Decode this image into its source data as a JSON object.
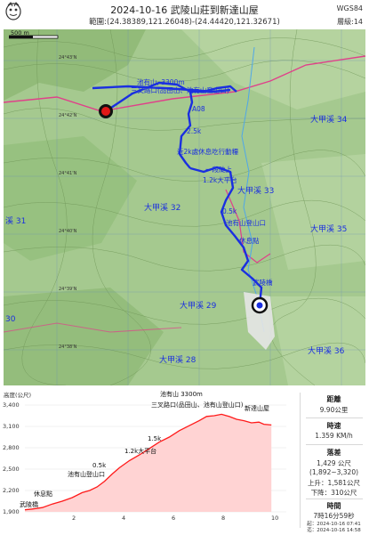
{
  "header": {
    "title": "2024-10-16 武陵山莊到新達山屋",
    "range": "範圍:(24.38389,121.26048)-(24.44420,121.32671)",
    "datum": "WGS84",
    "zoom": "層級:14"
  },
  "map": {
    "scale": "500 m",
    "streams": [
      {
        "label": "大甲溪 34"
      },
      {
        "label": "大甲溪 33"
      },
      {
        "label": "大甲溪 32"
      },
      {
        "label": "大甲溪 35"
      },
      {
        "label": "大甲溪 29"
      },
      {
        "label": "大甲溪 28"
      },
      {
        "label": "大甲溪 36"
      },
      {
        "label": "溪 31"
      },
      {
        "label": "30"
      }
    ],
    "grid_labels": [
      "24°43'N",
      "24°42'N",
      "24°41'N",
      "24°40'N",
      "24°39'N",
      "24°38'N"
    ],
    "waypoints": [
      "池有山, 3300m",
      "三叉路口(品田山、池有山登山口)",
      "A08",
      "2.5k",
      "近2k處休息吃行動糧",
      "一段陡上",
      "1.2k大平台",
      "0.5k",
      "池有山登山口",
      "休息點",
      "武陵橋"
    ],
    "colors": {
      "track": "#1a2fe0",
      "contour": "#7a9e63",
      "boundary": "#e0408a",
      "start": "#e01818",
      "end": "#111111"
    }
  },
  "profile": {
    "ylabel": "高度(公尺)",
    "y_ticks": [
      "3,400",
      "3,100",
      "2,800",
      "2,500",
      "2,200",
      "1,900"
    ],
    "x_ticks": [
      "2",
      "4",
      "6",
      "8",
      "10"
    ],
    "points_label": [
      "池有山 3300m",
      "三叉路口(品田山、池有山登山口)",
      "新達山屋",
      "1.5k",
      "1.2k大平台",
      "0.5k",
      "池有山登山口",
      "休息點",
      "武陵橋"
    ],
    "chart_data": {
      "type": "area",
      "x": [
        0,
        0.3,
        0.7,
        1.1,
        1.5,
        1.9,
        2.3,
        2.6,
        2.9,
        3.2,
        3.5,
        3.8,
        4.2,
        4.6,
        5.0,
        5.4,
        5.8,
        6.2,
        6.6,
        7.0,
        7.3,
        7.6,
        7.9,
        8.2,
        8.5,
        8.8,
        9.1,
        9.4,
        9.6,
        9.9
      ],
      "y": [
        1929,
        1940,
        1960,
        2010,
        2050,
        2100,
        2170,
        2200,
        2250,
        2330,
        2430,
        2520,
        2620,
        2700,
        2790,
        2880,
        2950,
        3040,
        3110,
        3180,
        3240,
        3250,
        3270,
        3240,
        3200,
        3180,
        3150,
        3160,
        3130,
        3120
      ],
      "xlim": [
        0,
        10.5
      ],
      "ylim": [
        1900,
        3400
      ],
      "ylabel": "高度(公尺)",
      "color": "#ff1a1a"
    }
  },
  "stats": {
    "distance_label": "距離",
    "distance_value": "9.90公里",
    "time_label": "時速",
    "time_value": "1.359 KM/h",
    "drop_label": "落差",
    "drop_value1": "1,429 公尺",
    "drop_value2": "(1,892~3,320)",
    "ascent_value": "上升：1,581公尺",
    "descent_value": "下降：310公尺",
    "duration_label": "時間",
    "duration_value": "7時16分59秒",
    "start_time": "起：2024-10-16 07:41",
    "end_time": "迄：2024-10-16 14:58"
  }
}
